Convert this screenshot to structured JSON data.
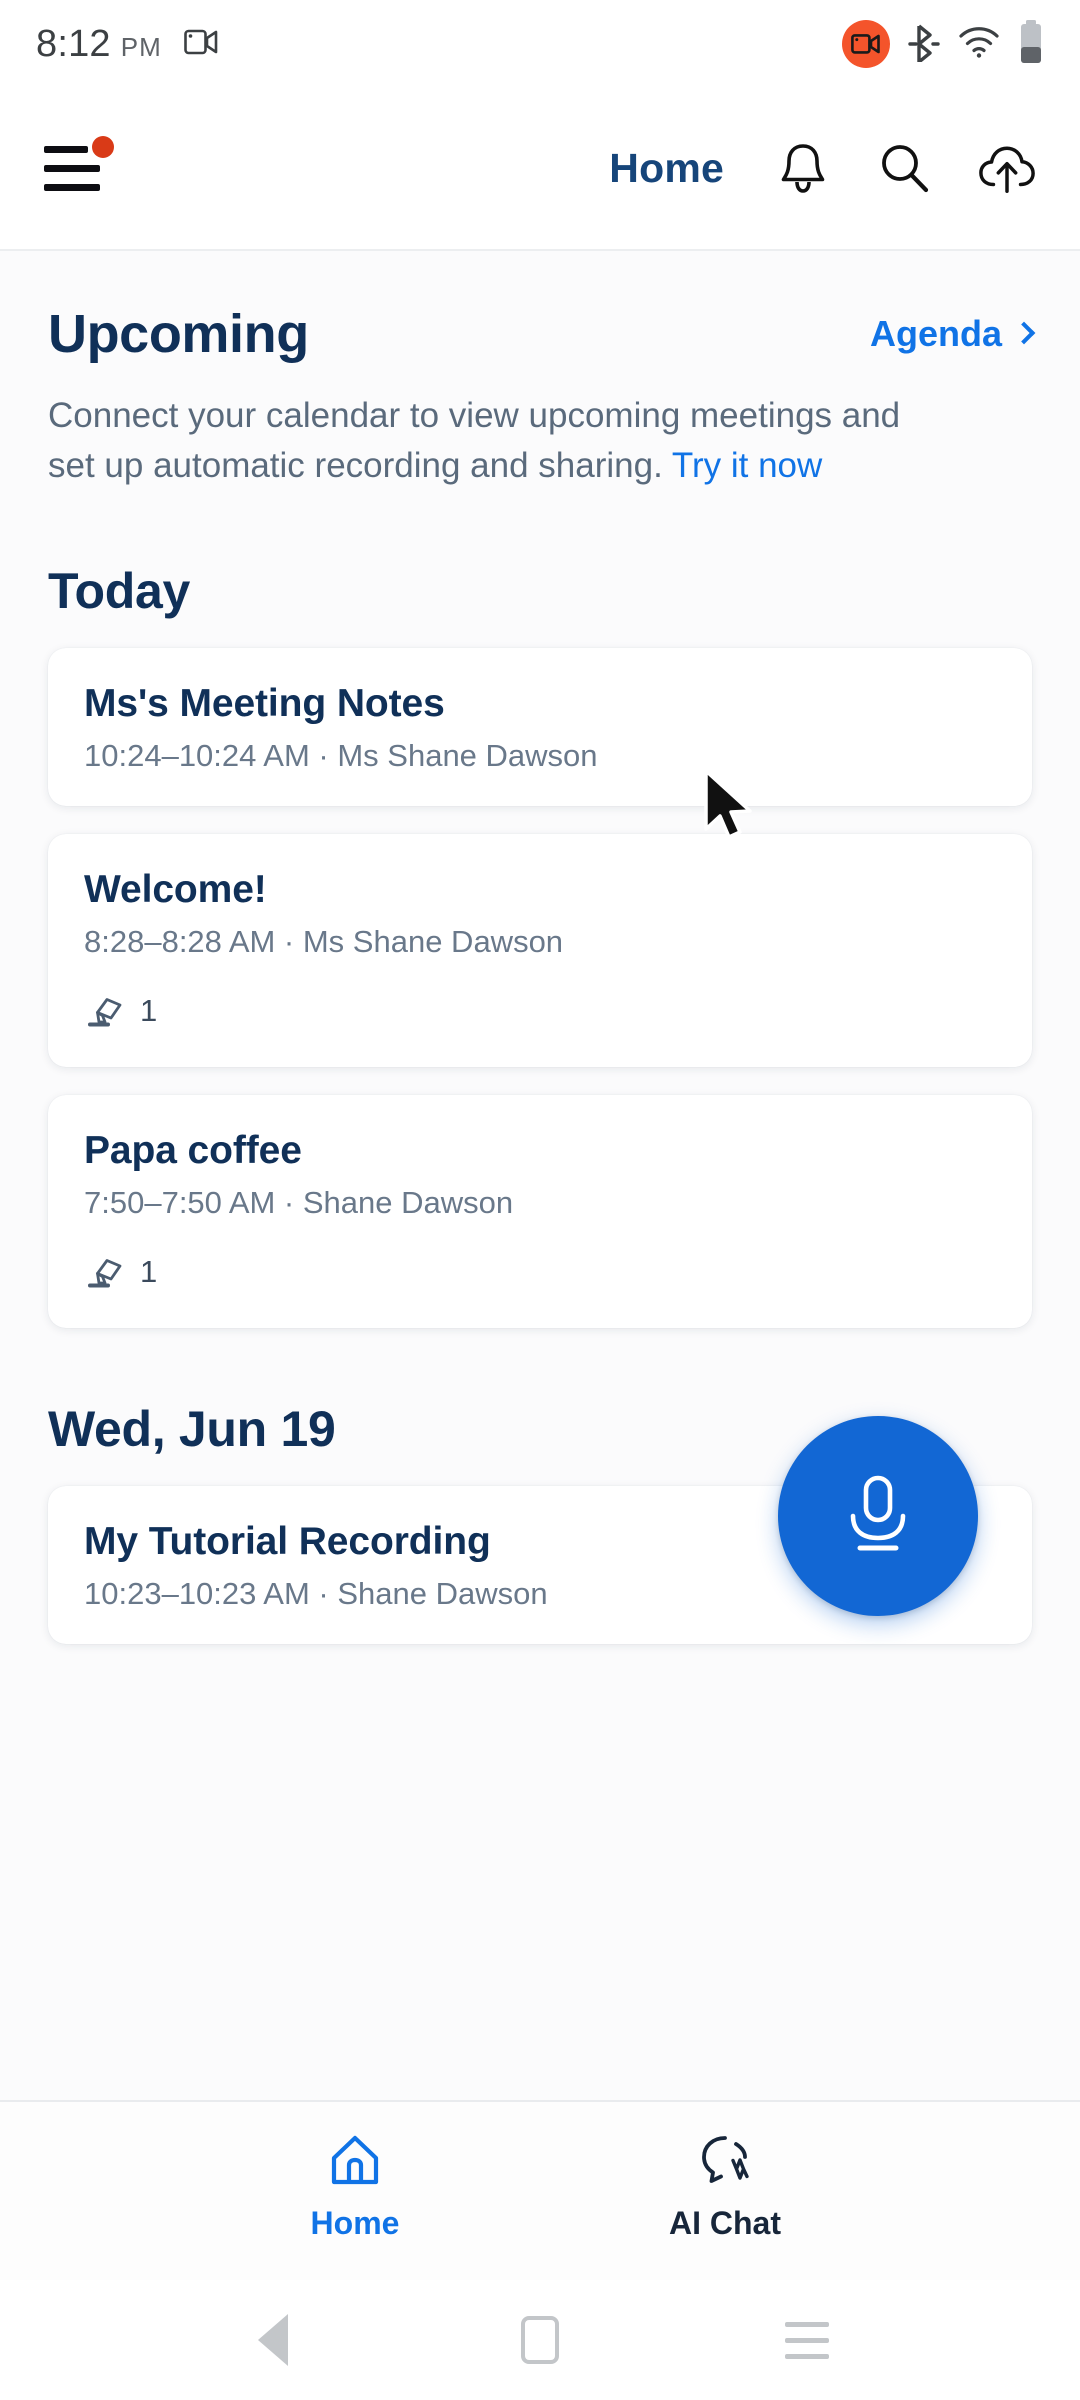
{
  "status_bar": {
    "time": "8:12",
    "ampm": "PM",
    "left_icon": "video-camera-icon",
    "right_icons": [
      "screen-record-icon",
      "bluetooth-icon",
      "wifi-icon",
      "battery-icon"
    ],
    "record_badge_color": "#f4542b"
  },
  "app_bar": {
    "menu_icon": "hamburger-menu-icon",
    "menu_badge": true,
    "title": "Home",
    "actions": [
      "bell-icon",
      "search-icon",
      "cloud-upload-icon"
    ]
  },
  "upcoming": {
    "heading": "Upcoming",
    "agenda_label": "Agenda",
    "description_part1": "Connect your calendar to view upcoming meetings and set up automatic recording and sharing. ",
    "description_link": "Try it now"
  },
  "sections": [
    {
      "heading": "Today",
      "cards": [
        {
          "title": "Ms's Meeting Notes",
          "subtitle": "10:24–10:24 AM ·  Ms Shane Dawson",
          "highlight_count": null
        },
        {
          "title": "Welcome!",
          "subtitle": "8:28–8:28 AM ·  Ms Shane Dawson",
          "highlight_count": "1"
        },
        {
          "title": "Papa coffee",
          "subtitle": "7:50–7:50 AM ·  Shane Dawson",
          "highlight_count": "1"
        }
      ]
    },
    {
      "heading": "Wed, Jun 19",
      "cards": [
        {
          "title": "My Tutorial Recording",
          "subtitle": "10:23–10:23 AM ·  Shane Dawson",
          "highlight_count": null
        }
      ]
    }
  ],
  "fab": {
    "icon": "microphone-icon",
    "color": "#1267d4"
  },
  "bottom_nav": {
    "items": [
      {
        "label": "Home",
        "icon": "home-icon",
        "active": true
      },
      {
        "label": "AI Chat",
        "icon": "ai-chat-bubble-icon",
        "active": false
      }
    ],
    "active_color": "#1073e6"
  },
  "system_nav": {
    "back": "back-triangle-icon",
    "home": "home-square-icon",
    "recents": "recents-lines-icon"
  },
  "colors": {
    "brand_blue": "#1073e6",
    "heading_navy": "#103058",
    "body_gray": "#5a6a7c",
    "background": "#fbfbfc"
  }
}
